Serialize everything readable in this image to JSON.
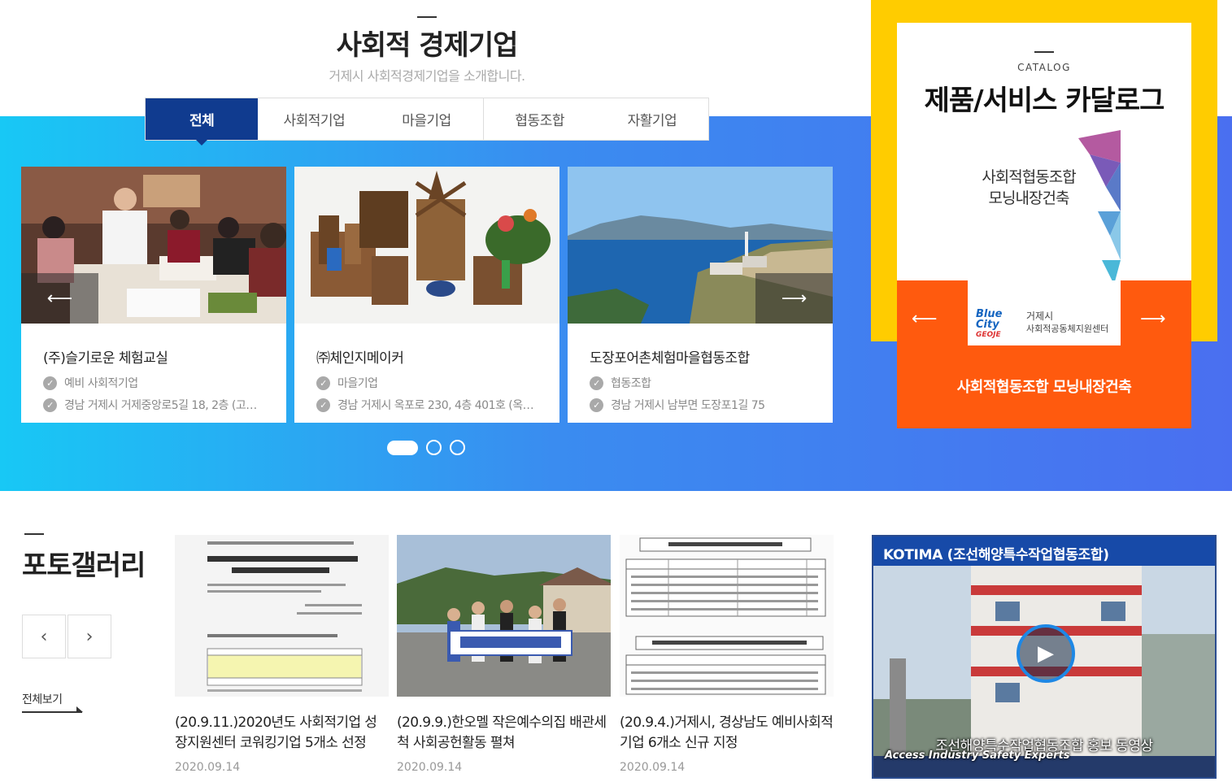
{
  "section": {
    "title": "사회적 경제기업",
    "subtitle": "거제시 사회적경제기업을 소개합니다."
  },
  "tabs": [
    {
      "label": "전체",
      "active": true
    },
    {
      "label": "사회적기업"
    },
    {
      "label": "마을기업"
    },
    {
      "label": "협동조합"
    },
    {
      "label": "자활기업"
    }
  ],
  "cards": [
    {
      "name": "(주)슬기로운 체험교실",
      "type": "예비 사회적기업",
      "address": "경남 거제시 거제중앙로5길 18, 2층 (고…"
    },
    {
      "name": "㈜체인지메이커",
      "type": "마을기업",
      "address": "경남 거제시 옥포로 230, 4층 401호 (옥…"
    },
    {
      "name": "도장포어촌체험마을협동조합",
      "type": "협동조합",
      "address": "경남 거제시 남부면 도장포1길 75"
    }
  ],
  "slider": {
    "page_count": 3,
    "current_page": 1
  },
  "catalog": {
    "label": "CATALOG",
    "title": "제품/서비스 카달로그",
    "book_title_1": "사회적협동조합",
    "book_title_2": "모닝내장건축",
    "book_logo_1": "Blue",
    "book_logo_2": "City",
    "book_logo_3": "GEOJE",
    "book_org_1": "거제시",
    "book_org_2": "사회적공동체지원센터",
    "caption": "사회적협동조합 모닝내장건축"
  },
  "gallery": {
    "title": "포토갤러리",
    "view_all": "전체보기",
    "items": [
      {
        "caption": "(20.9.11.)2020년도 사회적기업 성장지원센터 코워킹기업 5개소 선정",
        "date": "2020.09.14"
      },
      {
        "caption": "(20.9.9.)한오멜 작은예수의집 배관세척 사회공헌활동 펼쳐",
        "date": "2020.09.14"
      },
      {
        "caption": "(20.9.4.)거제시, 경상남도 예비사회적기업 6개소 신규 지정",
        "date": "2020.09.14"
      }
    ]
  },
  "video": {
    "header": "KOTIMA (조선해양특수작업협동조합)",
    "caption": "조선해양특수작업협동조합 홍보 동영상",
    "caption_en": "Access Industry Safety Experts"
  },
  "colors": {
    "accent_navy": "#103b8f",
    "catalog_yellow": "#ffcc00",
    "catalog_orange": "#ff5a0e"
  }
}
